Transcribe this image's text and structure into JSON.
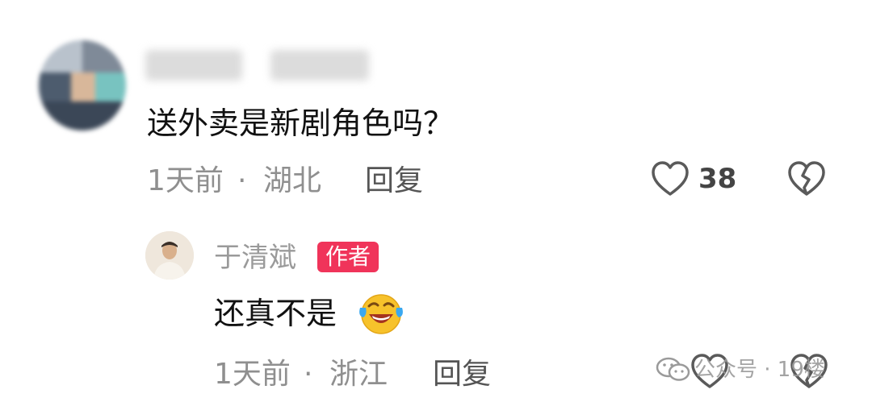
{
  "comments": [
    {
      "text": "送外卖是新剧角色吗？",
      "time": "1天前",
      "separator": "·",
      "location": "湖北",
      "reply_label": "回复",
      "like_count": "38"
    }
  ],
  "reply": {
    "author_name": "于清斌",
    "badge": "作者",
    "text": "还真不是",
    "emoji": "face-with-tears-of-joy-icon",
    "time": "1天前",
    "separator": "·",
    "location": "浙江",
    "reply_label": "回复"
  },
  "watermark": {
    "text": "公众号 · 19楼"
  },
  "colors": {
    "badge_bg": "#f0345a",
    "meta_gray": "#8f8f8f",
    "emoji_yellow": "#f7c22b",
    "emoji_tear": "#3aa8f0"
  }
}
